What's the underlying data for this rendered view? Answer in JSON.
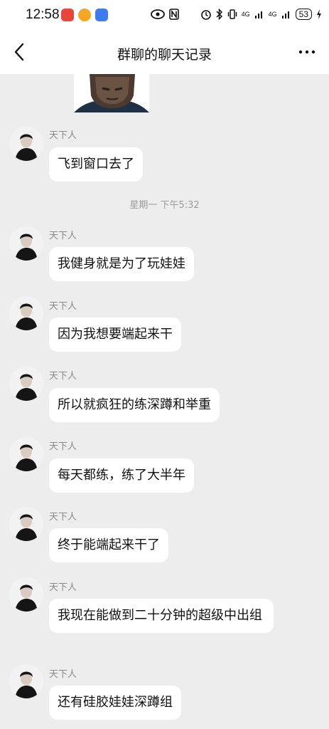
{
  "status_bar": {
    "time": "12:58",
    "signal_a": "4G",
    "signal_b": "4G",
    "battery": "53"
  },
  "header": {
    "title": "群聊的聊天记录"
  },
  "timestamp": "星期一 下午5:32",
  "messages": [
    {
      "sender": "天下人",
      "text": "飞到窗口去了"
    },
    {
      "sender": "天下人",
      "text": "我健身就是为了玩娃娃"
    },
    {
      "sender": "天下人",
      "text": "因为我想要端起来干"
    },
    {
      "sender": "天下人",
      "text": "所以就疯狂的练深蹲和举重"
    },
    {
      "sender": "天下人",
      "text": "每天都练，练了大半年"
    },
    {
      "sender": "天下人",
      "text": "终于能端起来干了"
    },
    {
      "sender": "天下人",
      "text": "我现在能做到二十分钟的超级中出组"
    },
    {
      "sender": "天下人",
      "text": "还有硅胶娃娃深蹲组"
    }
  ]
}
